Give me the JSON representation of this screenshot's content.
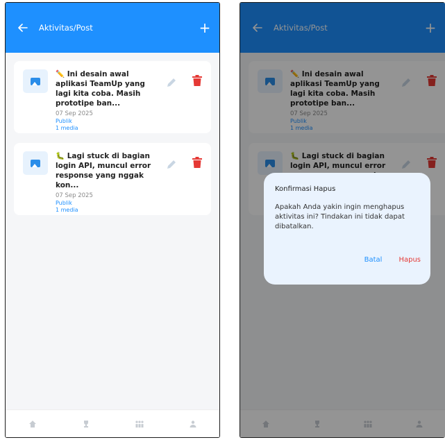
{
  "appbar": {
    "title": "Aktivitas/Post",
    "add_symbol": "+"
  },
  "posts": [
    {
      "emoji": "✏️",
      "text": "Ini desain awal aplikasi TeamUp yang lagi kita coba. Masih prototipe ban...",
      "date": "07 Sep 2025",
      "visibility": "Publik",
      "media": "1 media"
    },
    {
      "emoji": "🐛",
      "text": "Lagi stuck di bagian login API, muncul error response yang nggak kon...",
      "date": "07 Sep 2025",
      "visibility": "Publik",
      "media": "1 media"
    }
  ],
  "dialog": {
    "title": "Konfirmasi Hapus",
    "body": "Apakah Anda yakin ingin menghapus aktivitas ini? Tindakan ini tidak dapat dibatalkan.",
    "cancel": "Batal",
    "confirm": "Hapus"
  },
  "icons": {
    "back": "arrow-left-icon",
    "add": "plus-icon",
    "thumb": "image-icon",
    "edit": "pencil-icon",
    "delete": "trash-icon",
    "nav": [
      "home-icon",
      "trophy-icon",
      "people-icon",
      "person-icon"
    ]
  },
  "colors": {
    "primary": "#1e90ff",
    "danger": "#e53935",
    "overlay": "rgba(0,0,0,0.42)"
  }
}
